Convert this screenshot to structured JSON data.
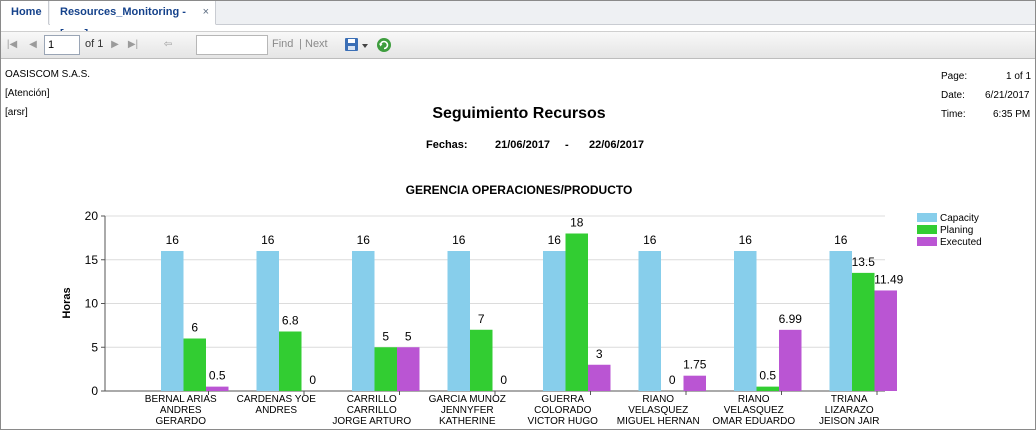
{
  "tabs": [
    {
      "label": "Home"
    },
    {
      "label": "Resources_Monitoring -[arsr]",
      "close": "×"
    }
  ],
  "toolbar": {
    "page_value": "1",
    "page_of": "of 1",
    "find_label": "Find",
    "separator": "|",
    "next_label": "Next",
    "find_value": ""
  },
  "report": {
    "company": "OASISCOM S.A.S.",
    "area": "[Atención]",
    "code": "[arsr]",
    "title": "Seguimiento Recursos",
    "dates_label": "Fechas:",
    "date_from": "21/06/2017",
    "date_sep": "-",
    "date_to": "22/06/2017",
    "page_label": "Page:",
    "page_value": "1 of 1",
    "date_label": "Date:",
    "date_value": "6/21/2017",
    "time_label": "Time:",
    "time_value": "6:35 PM"
  },
  "chart_data": {
    "type": "bar",
    "title": "GERENCIA OPERACIONES/PRODUCTO",
    "ylabel": "Horas",
    "ylim": [
      0,
      20
    ],
    "yticks": [
      "0",
      "5",
      "10",
      "15",
      "20"
    ],
    "grid": true,
    "legend_position": "top-right",
    "categories": [
      [
        "BERNAL ARIAS",
        "ANDRES",
        "GERARDO"
      ],
      [
        "CARDENAS  YOE",
        "ANDRES"
      ],
      [
        "CARRILLO",
        "CARRILLO",
        "JORGE ARTURO"
      ],
      [
        "GARCIA MUNOZ",
        "JENNYFER",
        "KATHERINE"
      ],
      [
        "GUERRA",
        "COLORADO",
        "VICTOR HUGO"
      ],
      [
        "RIANO",
        "VELASQUEZ",
        "MIGUEL HERNAN"
      ],
      [
        "RIANO",
        "VELASQUEZ",
        "OMAR EDUARDO"
      ],
      [
        "TRIANA",
        "LIZARAZO",
        "JEISON JAIR"
      ]
    ],
    "series": [
      {
        "name": "Capacity",
        "color": "#87ceeb",
        "values": [
          16,
          16,
          16,
          16,
          16,
          16,
          16,
          16
        ],
        "labels": [
          "16",
          "16",
          "16",
          "16",
          "16",
          "16",
          "16",
          "16"
        ]
      },
      {
        "name": "Planing",
        "color": "#32cd32",
        "values": [
          6,
          6.8,
          5,
          7,
          18,
          0,
          0.5,
          13.5
        ],
        "labels": [
          "6",
          "6.8",
          "5",
          "7",
          "18",
          "0",
          "0.5",
          "13.5"
        ]
      },
      {
        "name": "Executed",
        "color": "#ba55d3",
        "values": [
          0.5,
          0,
          5,
          0,
          3,
          1.75,
          6.99,
          11.49
        ],
        "labels": [
          "0.5",
          "0",
          "5",
          "0",
          "3",
          "1.75",
          "6.99",
          "11.49"
        ]
      }
    ]
  }
}
